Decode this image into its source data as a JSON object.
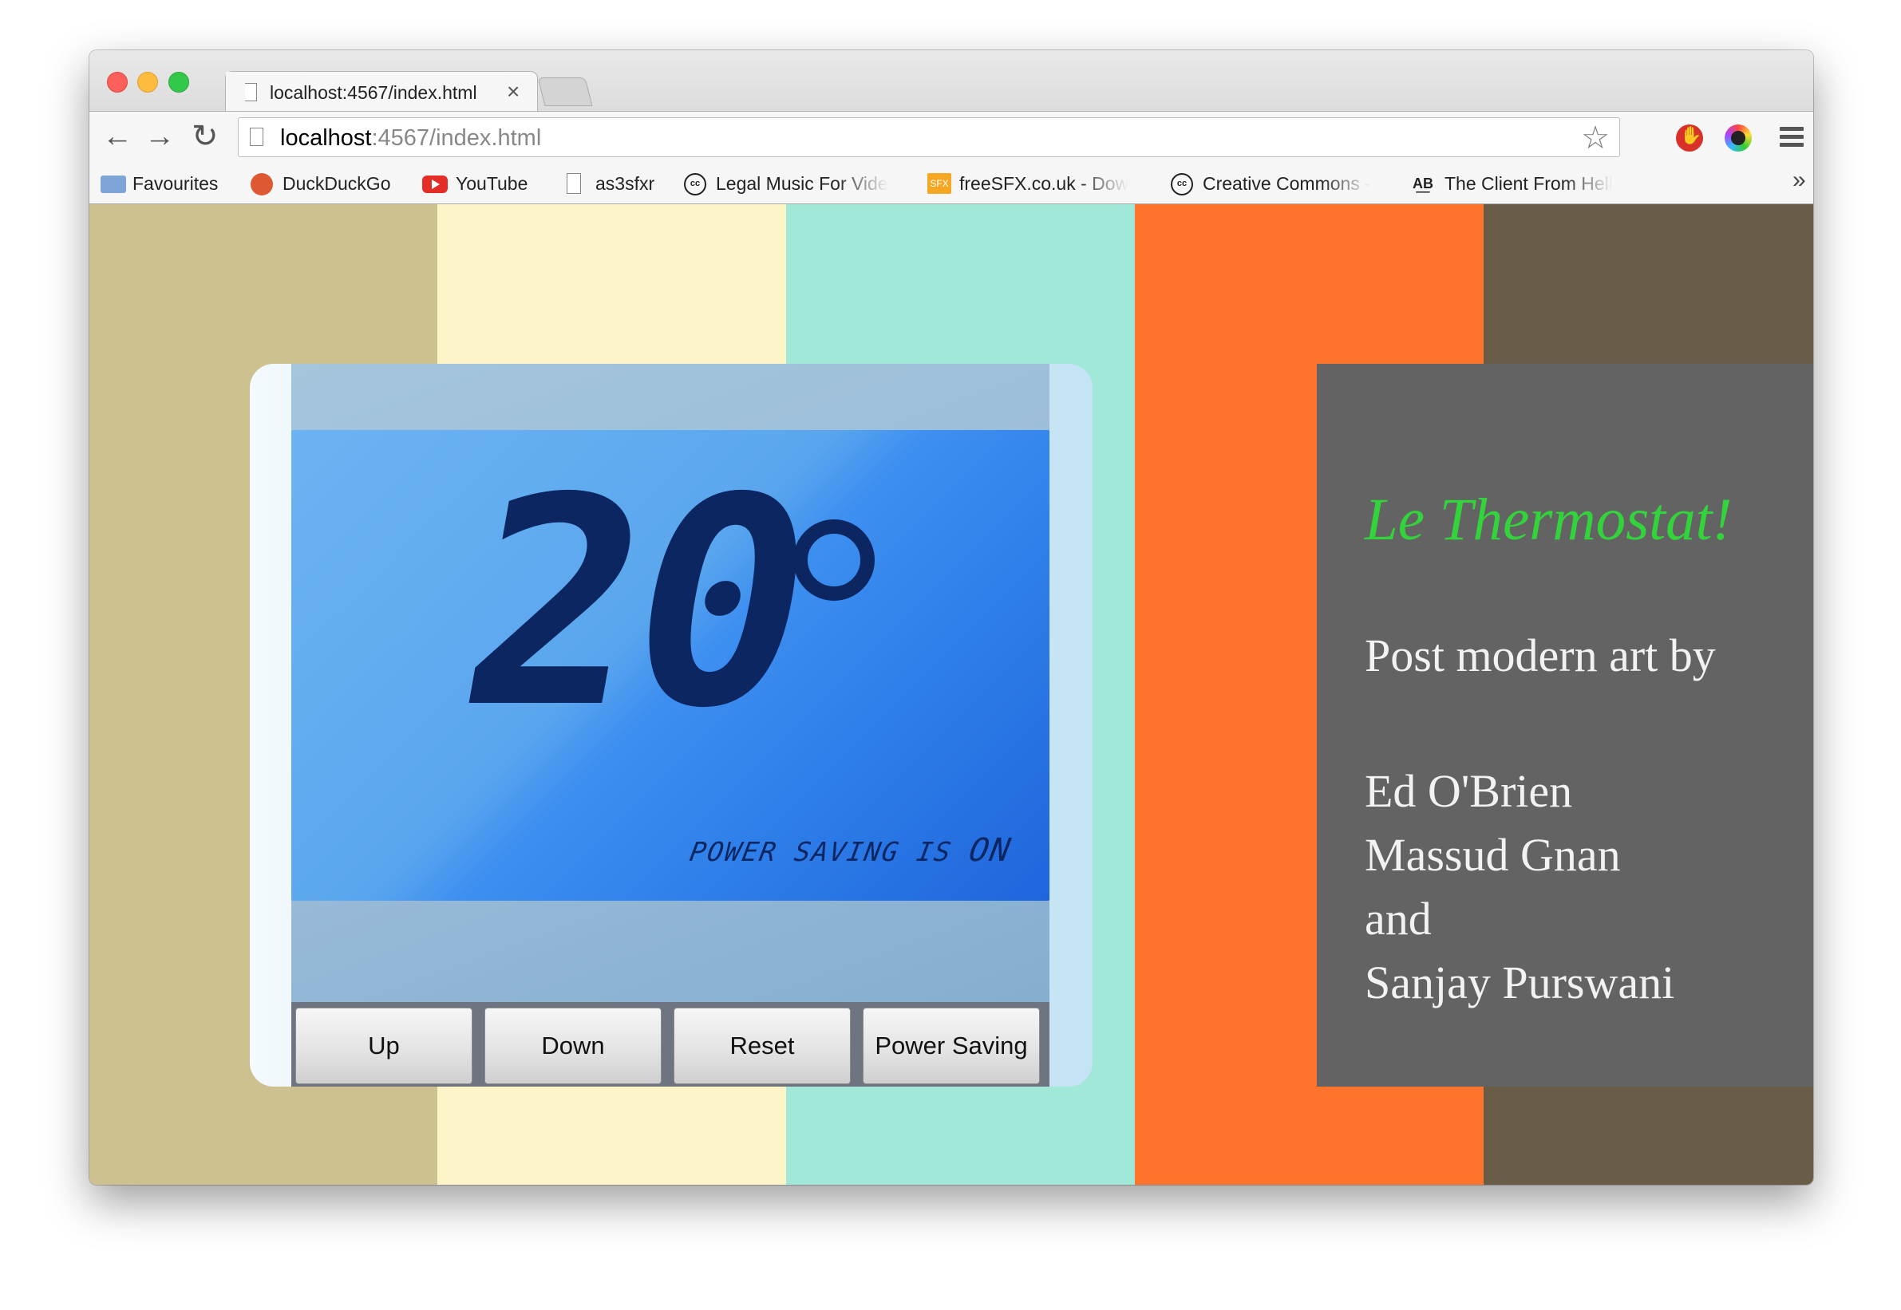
{
  "browser": {
    "tab_title": "localhost:4567/index.html",
    "tab_close": "×",
    "url_host": "localhost",
    "url_rest": ":4567/index.html",
    "back_glyph": "←",
    "forward_glyph": "→",
    "reload_glyph": "↻",
    "star_glyph": "☆",
    "bookmarks": [
      {
        "label": "Favourites",
        "icon": "folder-icon"
      },
      {
        "label": "DuckDuckGo",
        "icon": "duckduckgo-icon"
      },
      {
        "label": "YouTube",
        "icon": "youtube-icon"
      },
      {
        "label": "as3sfxr",
        "icon": "document-icon"
      },
      {
        "label": "Legal Music For Vide",
        "icon": "creative-commons-icon"
      },
      {
        "label": "freeSFX.co.uk - Dow",
        "icon": "sfx-icon"
      },
      {
        "label": "Creative Commons -",
        "icon": "creative-commons-icon"
      },
      {
        "label": "The Client From Hell",
        "icon": "ab-icon"
      }
    ],
    "bookmarks_overflow": "»"
  },
  "page": {
    "stripes": [
      "#cdc28f",
      "#fdf5c7",
      "#a1e8d8",
      "#fe742d",
      "#6a5d47"
    ],
    "thermostat": {
      "temperature": "20",
      "degree": "°",
      "status_prefix": "POWER SAVING IS ",
      "status_value": "ON",
      "buttons": {
        "up": "Up",
        "down": "Down",
        "reset": "Reset",
        "power_saving": "Power Saving"
      }
    },
    "sidebar": {
      "title": "Le Thermostat!",
      "subtitle": "Post modern art by",
      "authors": [
        "Ed O'Brien",
        "Massud Gnan",
        "and",
        "Sanjay Purswani"
      ]
    }
  },
  "colors": {
    "title_green": "#33d33b",
    "lcd_digits": "#0b2660",
    "sidebar_bg": "#636363"
  }
}
